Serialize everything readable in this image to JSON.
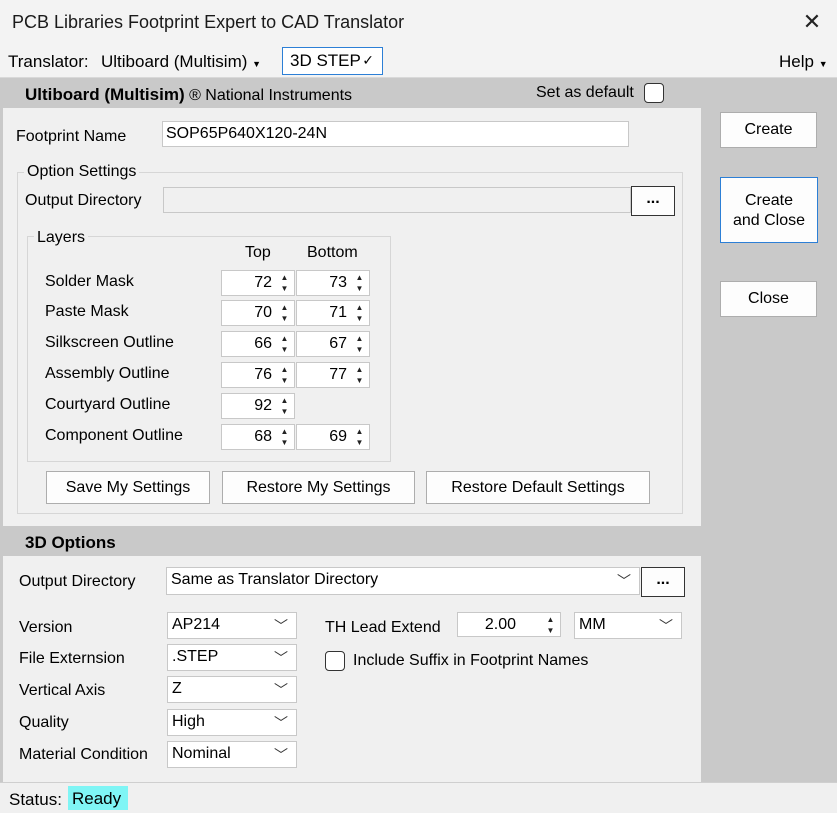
{
  "window": {
    "title": "PCB Libraries Footprint Expert to CAD Translator"
  },
  "menubar": {
    "translator_label": "Translator:",
    "translator_value": "Ultiboard (Multisim)",
    "format_value": "3D STEP",
    "format_check": "✓",
    "help_label": "Help"
  },
  "header": {
    "title_bold": "Ultiboard (Multisim)",
    "title_rest": "® National Instruments",
    "set_default_label": "Set as default",
    "set_default_checked": false
  },
  "footprint": {
    "label": "Footprint Name",
    "value": "SOP65P640X120-24N"
  },
  "option_settings": {
    "label": "Option Settings",
    "output_dir_label": "Output Directory",
    "output_dir_value": "",
    "browse_label": "...",
    "layers": {
      "label": "Layers",
      "col_top": "Top",
      "col_bottom": "Bottom",
      "rows": [
        {
          "name": "Solder Mask",
          "top": "72",
          "bottom": "73"
        },
        {
          "name": "Paste Mask",
          "top": "70",
          "bottom": "71"
        },
        {
          "name": "Silkscreen Outline",
          "top": "66",
          "bottom": "67"
        },
        {
          "name": "Assembly Outline",
          "top": "76",
          "bottom": "77"
        },
        {
          "name": "Courtyard Outline",
          "top": "92",
          "bottom": null
        },
        {
          "name": "Component Outline",
          "top": "68",
          "bottom": "69"
        }
      ]
    },
    "save_label": "Save My Settings",
    "restore_label": "Restore My Settings",
    "restore_default_label": "Restore Default Settings"
  },
  "side_buttons": {
    "create": "Create",
    "create_close_1": "Create",
    "create_close_2": "and Close",
    "close": "Close"
  },
  "options_3d": {
    "title": "3D Options",
    "output_dir_label": "Output Directory",
    "output_dir_value": "Same as Translator Directory",
    "browse_label": "...",
    "version_label": "Version",
    "version_value": "AP214",
    "ext_label": "File Externsion",
    "ext_value": ".STEP",
    "axis_label": "Vertical Axis",
    "axis_value": "Z",
    "quality_label": "Quality",
    "quality_value": "High",
    "material_label": "Material Condition",
    "material_value": "Nominal",
    "lead_label": "TH Lead Extend",
    "lead_value": "2.00",
    "unit_value": "MM",
    "suffix_label": "Include Suffix in Footprint Names",
    "suffix_checked": false
  },
  "status": {
    "label": "Status:",
    "value": "Ready"
  },
  "colors": {
    "accent": "#2c7fd6",
    "ready_bg": "#7ff5f5",
    "header_bg": "#c9c9c9"
  }
}
